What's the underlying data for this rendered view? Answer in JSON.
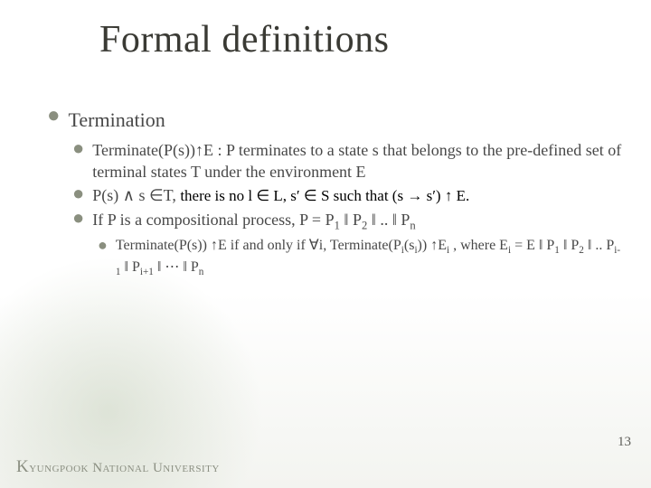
{
  "title": "Formal definitions",
  "section": "Termination",
  "bullets": {
    "b1": "Terminate(P(s))↑E : P terminates to a state s that belongs to the pre-defined set of terminal states T under the environment E",
    "b2_prefix": "P(s) ∧ s ∈T, ",
    "b2_image_text": "there is no l ∈ L, s′ ∈ S such that (s → s′) ↑ E.",
    "b3_prefix": "If P is a compositional process, P = P",
    "b3_mid": " ‖ P",
    "b3_dots": " ‖ .. ‖ P",
    "sub1": "1",
    "sub2": "2",
    "subn": "n",
    "c1_a": "Terminate(P(s)) ↑E  if and only if ∀i, Terminate(P",
    "c1_b": "(s",
    "c1_c": ")) ↑E",
    "c1_d": " , where E",
    "c1_e": " = E  ‖ P",
    "c1_f": " ‖ P",
    "c1_g": " ‖ .. P",
    "c1_h": " ‖ P",
    "c1_i": " ‖ ⋯  ‖ P",
    "subi": "i",
    "sub_im1": "i-1",
    "sub_ip1": "i+1"
  },
  "footer": {
    "k": "K",
    "rest": "yungpook National University"
  },
  "page": "13"
}
